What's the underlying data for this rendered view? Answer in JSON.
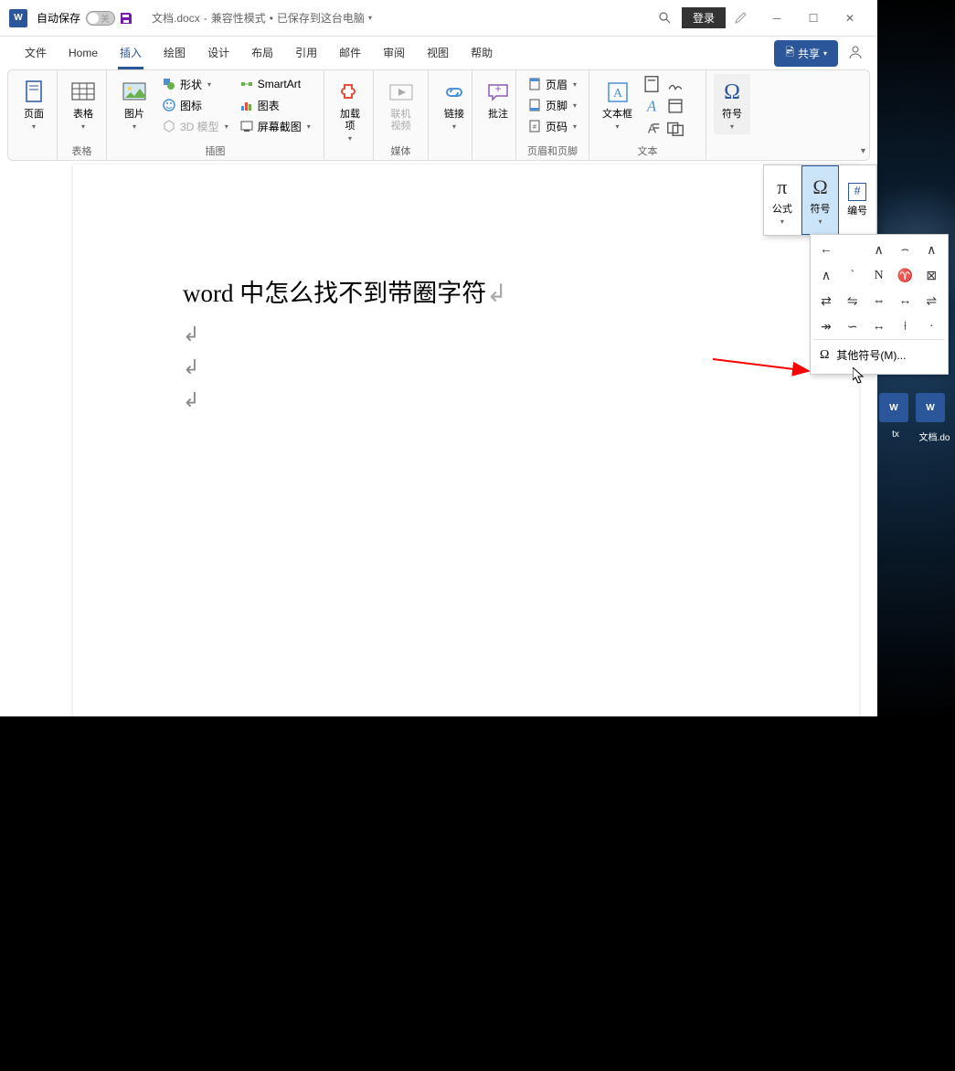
{
  "titleBar": {
    "autosaveLabel": "自动保存",
    "autosaveToggleText": "关",
    "filename": "文档.docx",
    "compatMode": "兼容性模式",
    "savedStatus": "已保存到这台电脑",
    "loginButton": "登录"
  },
  "menuBar": {
    "items": [
      "文件",
      "Home",
      "插入",
      "绘图",
      "设计",
      "布局",
      "引用",
      "邮件",
      "审阅",
      "视图",
      "帮助"
    ],
    "activeIndex": 2,
    "shareButton": "共享"
  },
  "ribbon": {
    "groups": {
      "pages": {
        "label": "",
        "pageButton": "页面"
      },
      "tables": {
        "label": "表格",
        "tableButton": "表格"
      },
      "illustrations": {
        "label": "插图",
        "pictureButton": "图片",
        "shapesButton": "形状",
        "iconsButton": "图标",
        "threeDButton": "3D 模型",
        "smartartButton": "SmartArt",
        "chartButton": "图表",
        "screenshotButton": "屏幕截图"
      },
      "addins": {
        "label": "",
        "addinsButton": "加载项"
      },
      "media": {
        "label": "媒体",
        "videoButton": "联机视频"
      },
      "links": {
        "label": "",
        "linkButton": "链接"
      },
      "comments": {
        "label": "",
        "commentButton": "批注"
      },
      "headerFooter": {
        "label": "页眉和页脚",
        "headerButton": "页眉",
        "footerButton": "页脚",
        "pageNumberButton": "页码"
      },
      "text": {
        "label": "文本",
        "textboxButton": "文本框"
      },
      "symbols": {
        "label": "",
        "symbolButton": "符号"
      }
    }
  },
  "symbolPanel": {
    "tabs": {
      "equation": "公式",
      "symbol": "符号",
      "number": "编号"
    },
    "symbols": [
      "←",
      "",
      "∧",
      "⌢",
      "∧",
      "∧",
      "`",
      "Ν",
      "♈",
      "⊠",
      "⇄",
      "⇋",
      "⇔",
      "↔",
      "⇌",
      "↠",
      "∽",
      "↔",
      "⟊",
      "·"
    ],
    "moreSymbolsText": "其他符号(M)..."
  },
  "document": {
    "text": "word 中怎么找不到带圈字符"
  },
  "desktop": {
    "file1": "tx",
    "file2": "文档.do"
  }
}
